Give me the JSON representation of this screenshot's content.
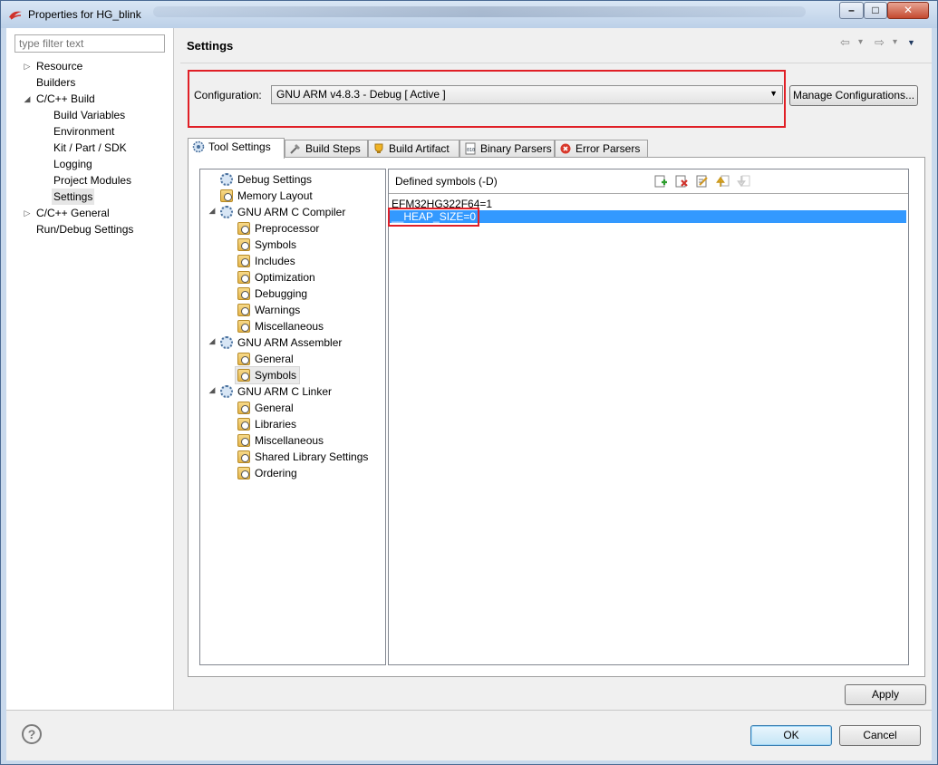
{
  "window": {
    "title": "Properties for HG_blink",
    "controls": {
      "minimize": "–",
      "maximize": "□",
      "close": "✕"
    }
  },
  "filter": {
    "placeholder": "type filter text"
  },
  "nav_tree": {
    "items": [
      {
        "label": "Resource",
        "expander": "▷"
      },
      {
        "label": "Builders"
      },
      {
        "label": "C/C++ Build",
        "expander": "◢"
      },
      {
        "label": "Build Variables"
      },
      {
        "label": "Environment"
      },
      {
        "label": "Kit / Part / SDK"
      },
      {
        "label": "Logging"
      },
      {
        "label": "Project Modules"
      },
      {
        "label": "Settings",
        "selected": true
      },
      {
        "label": "C/C++ General",
        "expander": "▷"
      },
      {
        "label": "Run/Debug Settings"
      }
    ]
  },
  "page": {
    "title": "Settings",
    "nav": {
      "back": "⇦",
      "back_menu": "▾",
      "forward": "⇨",
      "forward_menu": "▾",
      "view_menu": "▼"
    }
  },
  "configuration": {
    "label": "Configuration:",
    "value": "GNU ARM v4.8.3 - Debug  [ Active ]",
    "manage_button": "Manage Configurations..."
  },
  "tabs": [
    {
      "label": "Tool Settings",
      "active": true,
      "icon": "tool-settings-icon"
    },
    {
      "label": "Build Steps",
      "icon": "build-steps-icon"
    },
    {
      "label": "Build Artifact",
      "icon": "build-artifact-icon"
    },
    {
      "label": "Binary Parsers",
      "icon": "binary-parsers-icon"
    },
    {
      "label": "Error Parsers",
      "icon": "error-parsers-icon"
    }
  ],
  "tool_tree": {
    "debug_settings": "Debug Settings",
    "memory_layout": "Memory Layout",
    "c_compiler": {
      "label": "GNU ARM C Compiler",
      "children": [
        "Preprocessor",
        "Symbols",
        "Includes",
        "Optimization",
        "Debugging",
        "Warnings",
        "Miscellaneous"
      ]
    },
    "assembler": {
      "label": "GNU ARM Assembler",
      "children": [
        "General",
        "Symbols"
      ]
    },
    "linker": {
      "label": "GNU ARM C Linker",
      "children": [
        "General",
        "Libraries",
        "Miscellaneous",
        "Shared Library Settings",
        "Ordering"
      ]
    },
    "expander": "◢",
    "selected": "GNU ARM Assembler / Symbols"
  },
  "symbols": {
    "header": "Defined symbols (-D)",
    "toolbar": [
      "add-icon",
      "delete-icon",
      "edit-icon",
      "move-up-icon",
      "move-down-icon"
    ],
    "entries": [
      "EFM32HG322F64=1",
      "__HEAP_SIZE=0"
    ],
    "selected_index": 1
  },
  "buttons": {
    "apply": "Apply",
    "ok": "OK",
    "cancel": "Cancel",
    "help": "?"
  },
  "colors": {
    "highlight_box": "#e01f26",
    "selection": "#3399ff"
  }
}
